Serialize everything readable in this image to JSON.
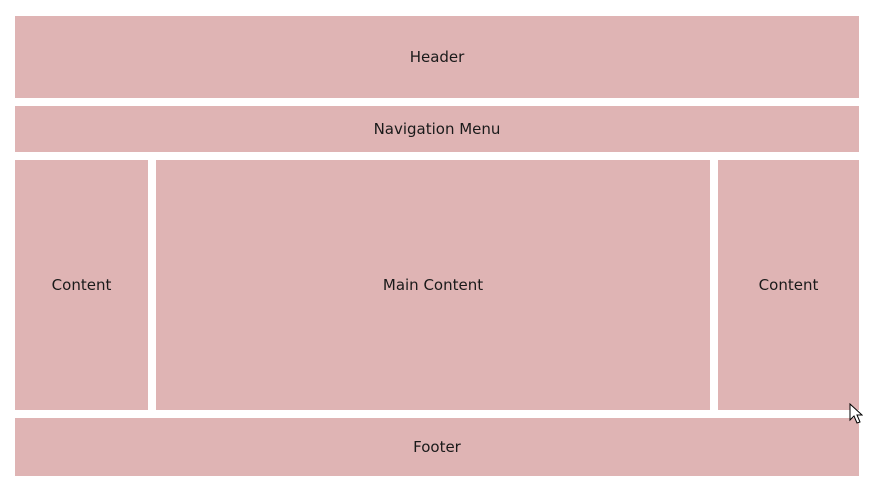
{
  "layout": {
    "header": "Header",
    "navigation": "Navigation Menu",
    "left_sidebar": "Content",
    "main": "Main Content",
    "right_sidebar": "Content",
    "footer": "Footer"
  },
  "colors": {
    "block_background": "#dfb4b4",
    "page_background": "#ffffff",
    "text": "#1a1a1a"
  },
  "icons": {
    "cursor": "mouse-pointer-icon"
  }
}
